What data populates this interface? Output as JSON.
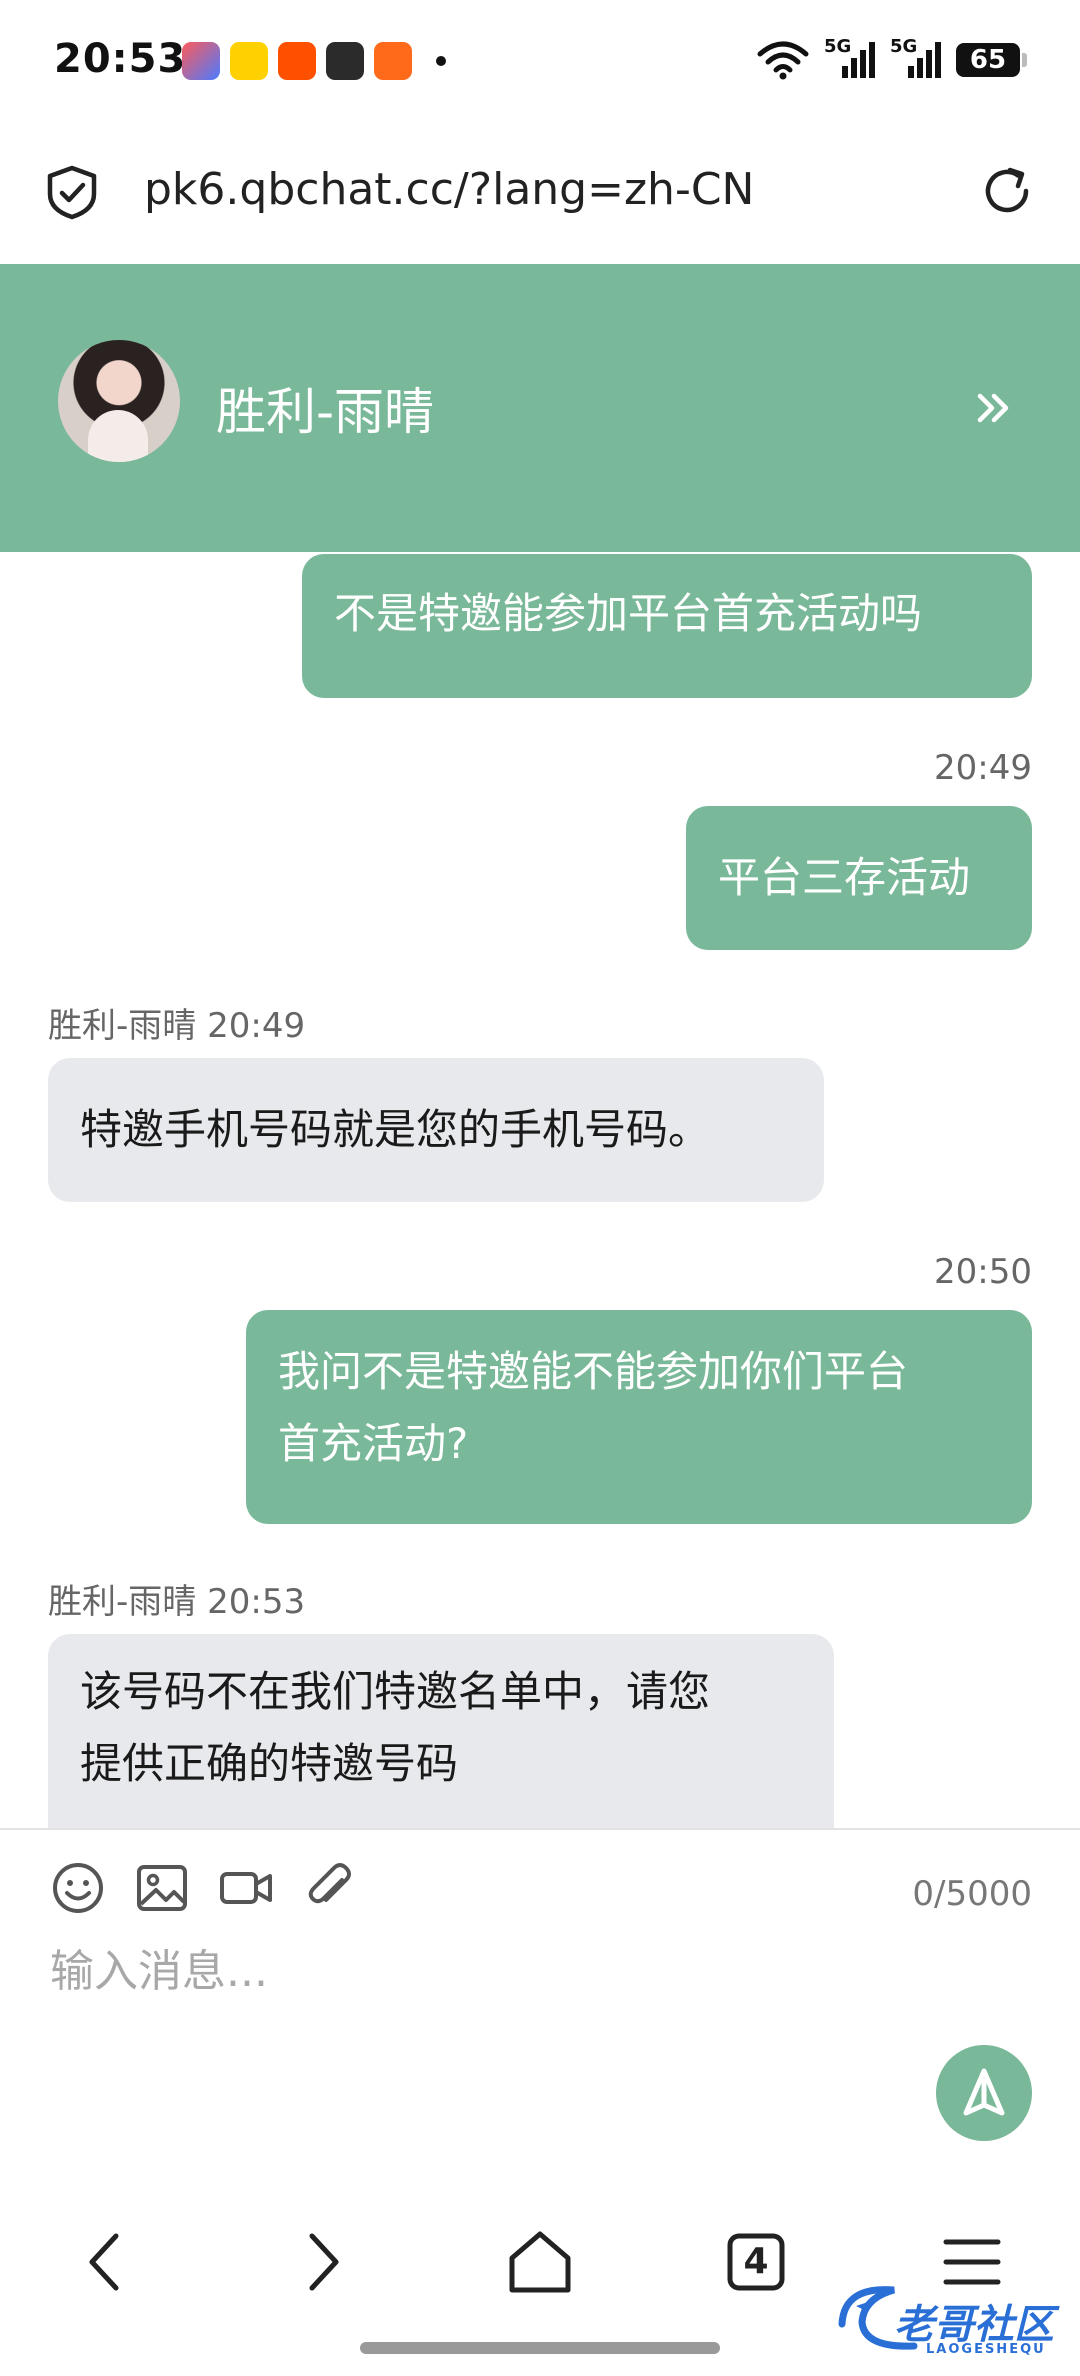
{
  "status_bar": {
    "time": "20:53",
    "battery": "65",
    "network_1": "5G",
    "network_2": "5G"
  },
  "browser": {
    "url": "pk6.qbchat.cc/?lang=zh-CN",
    "tab_count": "4"
  },
  "chat": {
    "contact_name": "胜利-雨晴",
    "messages": [
      {
        "direction": "out",
        "text": "不是特邀能参加平台首充活动吗"
      },
      {
        "direction": "out",
        "time": "20:49",
        "text": "平台三存活动"
      },
      {
        "direction": "in",
        "sender": "胜利-雨晴",
        "time": "20:49",
        "text": "特邀手机号码就是您的手机号码。"
      },
      {
        "direction": "out",
        "time": "20:50",
        "text_line1": "我问不是特邀能不能参加你们平台",
        "text_line2": "首充活动?"
      },
      {
        "direction": "in",
        "sender": "胜利-雨晴",
        "time": "20:53",
        "text_line1": "该号码不在我们特邀名单中，请您",
        "text_line2": "提供正确的特邀号码"
      }
    ]
  },
  "composer": {
    "placeholder": "输入消息...",
    "counter": "0/5000",
    "tools": [
      "emoji-icon",
      "image-icon",
      "video-icon",
      "attachment-icon"
    ]
  },
  "watermark": {
    "text": "老哥社区",
    "subtext": "LAOGESHEQU"
  },
  "colors": {
    "accent": "#79b898",
    "incoming_bubble": "#e8e9ec"
  }
}
